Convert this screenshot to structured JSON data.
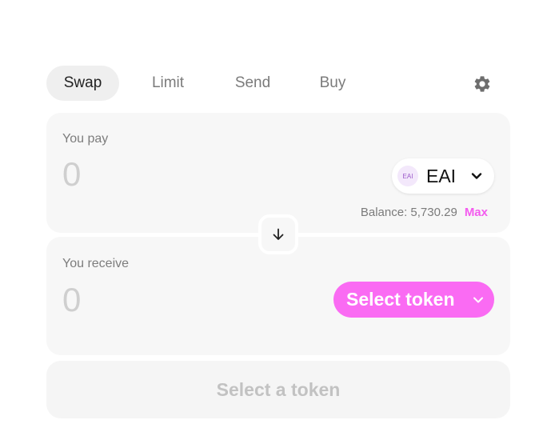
{
  "tabs": [
    {
      "label": "Swap",
      "active": true
    },
    {
      "label": "Limit",
      "active": false
    },
    {
      "label": "Send",
      "active": false
    },
    {
      "label": "Buy",
      "active": false
    }
  ],
  "settings_icon": "gear-icon",
  "pay": {
    "label": "You pay",
    "amount": "0",
    "token": {
      "logo_text": "EAI",
      "symbol": "EAI"
    },
    "balance_text": "Balance: 5,730.29",
    "max_label": "Max"
  },
  "switch_icon": "arrow-down-icon",
  "receive": {
    "label": "You receive",
    "amount": "0",
    "select_token_label": "Select token"
  },
  "cta_label": "Select a token",
  "colors": {
    "accent": "#fa6bf3",
    "max": "#f45bef",
    "panel_bg": "#f7f7f7",
    "tab_active_bg": "#efefef"
  }
}
